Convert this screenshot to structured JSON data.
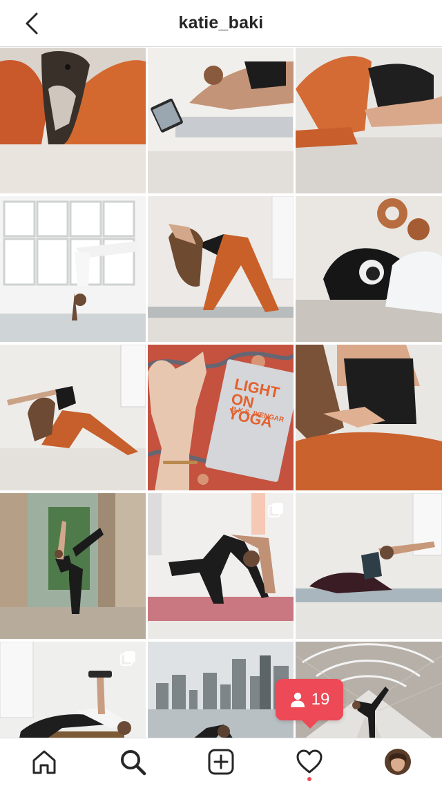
{
  "header": {
    "username": "katie_baki",
    "back_icon": "chevron-left-icon"
  },
  "grid": {
    "posts": [
      {
        "subject": "dog lying on orange blanket",
        "multi": false
      },
      {
        "subject": "woman in plank pose with tablet",
        "multi": false
      },
      {
        "subject": "woman stretching in orange pants",
        "multi": false
      },
      {
        "subject": "woman in handstand by windows",
        "multi": false
      },
      {
        "subject": "woman in wide-leg forward bend",
        "multi": false
      },
      {
        "subject": "black dog on couch",
        "multi": false
      },
      {
        "subject": "woman in side lunge twist",
        "multi": false
      },
      {
        "subject": "hand over Light on Yoga book",
        "multi": false,
        "book_title": "LIGHT ON YOGA",
        "book_author": "B.K.S. IYENGAR"
      },
      {
        "subject": "woman seated close-up",
        "multi": false
      },
      {
        "subject": "dancer pose between stone pillars",
        "multi": false
      },
      {
        "subject": "backbend on mat",
        "multi": true
      },
      {
        "subject": "woman in side stretch",
        "multi": false
      },
      {
        "subject": "dumbbell press on bench",
        "multi": true
      },
      {
        "subject": "pose in front of city skyline",
        "multi": false
      },
      {
        "subject": "dancer pose on pedestrian bridge",
        "multi": false
      }
    ]
  },
  "notification": {
    "icon": "user-icon",
    "count": "19"
  },
  "tabbar": {
    "tabs": [
      "home-icon",
      "search-icon",
      "add-post-icon",
      "heart-icon",
      "profile-avatar"
    ],
    "activity_dot_color": "#ed4956"
  },
  "colors": {
    "notification_bg": "#ed4956",
    "text": "#262626",
    "divider": "#dbdbdb"
  }
}
